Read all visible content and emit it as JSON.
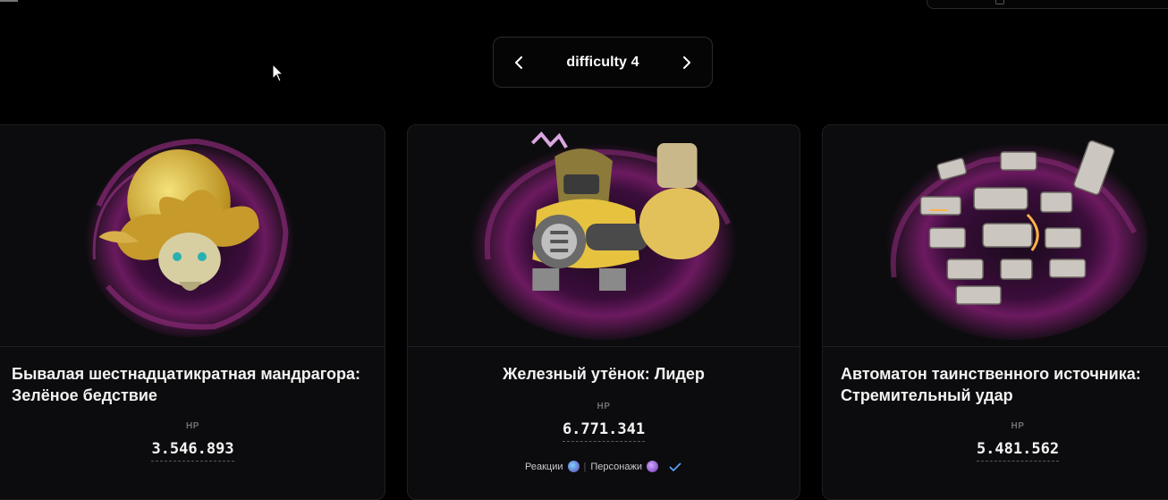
{
  "pager": {
    "label": "difficulty 4",
    "prev_icon": "chevron-left-icon",
    "next_icon": "chevron-right-icon"
  },
  "cards": [
    {
      "name": "Бывалая шестнадцатикратная мандрагора: Зелёное бедствие",
      "hp_label": "HP",
      "hp": "3.546.893"
    },
    {
      "name": "Железный утёнок: Лидер",
      "hp_label": "HP",
      "hp": "6.771.341",
      "meta": {
        "reactions_label": "Реакции",
        "characters_label": "Персонажи",
        "separator": "|"
      }
    },
    {
      "name": "Автоматон таинственного источника: Стремительный удар",
      "hp_label": "HP",
      "hp": "5.481.562"
    }
  ],
  "colors": {
    "background": "#000000",
    "card": "#0c0c0e",
    "border": "#1e1e22",
    "accent_check": "#5aa9ff"
  }
}
